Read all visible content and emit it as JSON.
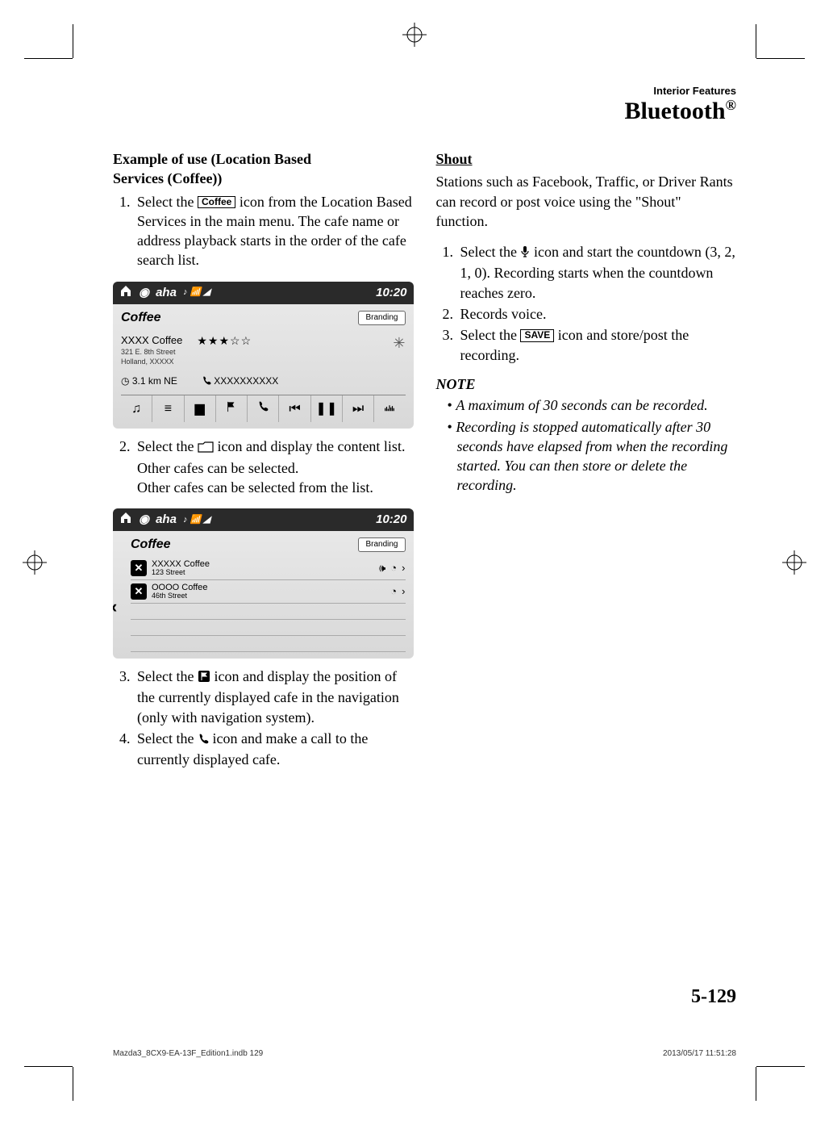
{
  "header": {
    "small": "Interior Features",
    "large": "Bluetooth",
    "registered": "®"
  },
  "left": {
    "example_title_l1": "Example of use (Location Based",
    "example_title_l2": "Services (Coffee))",
    "step1_a": "Select the ",
    "step1_icon": "Coffee",
    "step1_b": " icon from the Location Based Services in the main menu. The cafe name or address playback starts in the order of the cafe search list.",
    "ss1": {
      "app": "aha",
      "time": "10:20",
      "title": "Coffee",
      "branding": "Branding",
      "cafe_name": "XXXX Coffee",
      "addr1": "321 E. 8th Street",
      "addr2": "Holland, XXXXX",
      "stars": "★★★☆☆",
      "distance": "3.1 km NE",
      "phone": "XXXXXXXXXX"
    },
    "step2_a": "Select the ",
    "step2_b": " icon and display the content list. Other cafes can be selected.",
    "step2_c": "Other cafes can be selected from the list.",
    "ss2": {
      "app": "aha",
      "time": "10:20",
      "title": "Coffee",
      "branding": "Branding",
      "row1_name": "XXXXX Coffee",
      "row1_addr": "123 Street",
      "row2_name": "OOOO Coffee",
      "row2_addr": "46th Street"
    },
    "step3_a": "Select the ",
    "step3_b": " icon and display the position of the currently displayed cafe in the navigation (only with navigation system).",
    "step4_a": "Select the",
    "step4_b": " icon and make a call to the currently displayed cafe."
  },
  "right": {
    "shout_title": "Shout",
    "shout_body": "Stations such as Facebook, Traffic, or Driver Rants can record or post voice using the \"Shout\" function.",
    "step1_a": "Select the ",
    "step1_b": " icon and start the countdown (3, 2, 1, 0). Recording starts when the countdown reaches zero.",
    "step2": "Records voice.",
    "step3_a": "Select the ",
    "step3_icon": "SAVE",
    "step3_b": " icon and store/post the recording.",
    "note_label": "NOTE",
    "note1": "A maximum of 30 seconds can be recorded.",
    "note2": "Recording is stopped automatically after 30 seconds have elapsed from when the recording started. You can then store or delete the recording."
  },
  "page_num": "5-129",
  "footer": {
    "left": "Mazda3_8CX9-EA-13F_Edition1.indb   129",
    "right": "2013/05/17   11:51:28"
  }
}
